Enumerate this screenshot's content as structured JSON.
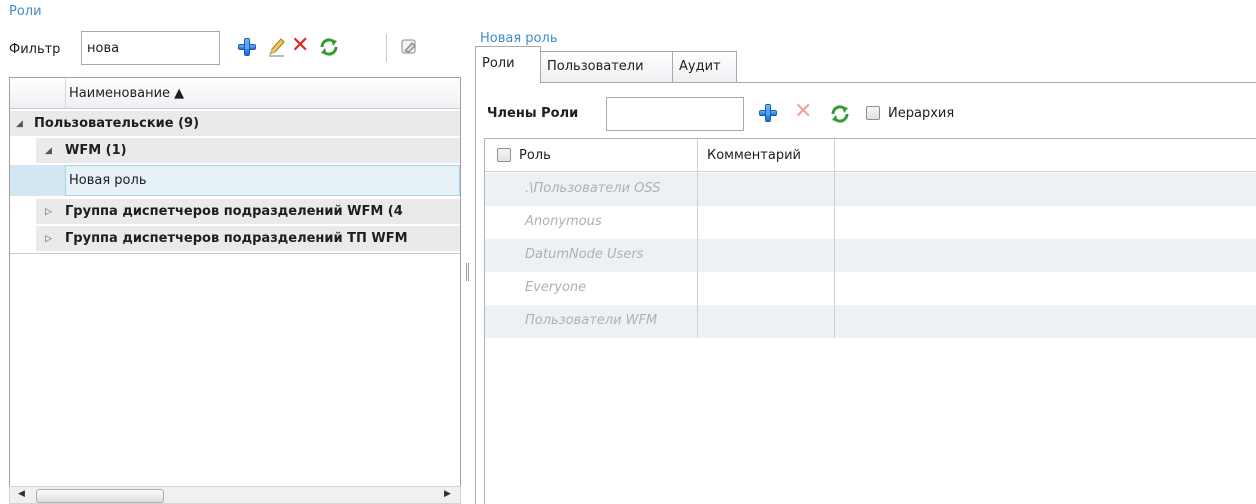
{
  "left": {
    "section_title": "Роли",
    "filter_label": "Фильтр",
    "filter_value": "нова",
    "toolbar": {
      "add_icon": "plus-icon",
      "edit_icon": "pencil-icon",
      "delete_icon": "close-icon",
      "refresh_icon": "refresh-icon",
      "clear_filter_icon": "eraser-icon"
    },
    "grid": {
      "column_header": "Наименование ▲",
      "rows": [
        {
          "label": "Пользовательские (9)",
          "kind": "group",
          "expanded": true
        },
        {
          "label": "WFM (1)",
          "kind": "subgroup",
          "expanded": true
        },
        {
          "label": "Новая роль",
          "kind": "item",
          "selected": true
        },
        {
          "label": "Группа диспетчеров подразделений WFM (4",
          "kind": "subgroup",
          "expanded": false
        },
        {
          "label": "Группа диспетчеров подразделений ТП WFM",
          "kind": "subgroup",
          "expanded": false
        }
      ]
    }
  },
  "right": {
    "section_title": "Новая роль",
    "tabs": [
      {
        "label": "Роли",
        "active": true
      },
      {
        "label": "Пользователи",
        "active": false
      },
      {
        "label": "Аудит",
        "active": false
      }
    ],
    "members_label": "Члены Роли",
    "members_input_value": "",
    "hierarchy_label": "Иерархия",
    "grid": {
      "columns": [
        "Роль",
        "Комментарий"
      ],
      "rows": [
        {
          "role": ".\\Пользователи OSS",
          "comment": ""
        },
        {
          "role": "Anonymous",
          "comment": ""
        },
        {
          "role": "DatumNode Users",
          "comment": ""
        },
        {
          "role": "Everyone",
          "comment": ""
        },
        {
          "role": "Пользователи WFM",
          "comment": ""
        }
      ]
    }
  },
  "colors": {
    "accent_link": "#3c8dcb",
    "selected_row": "#d2e7f1",
    "group_row": "#e9eaec",
    "delete_red": "#e0261b",
    "refresh_green": "#2e9e2e"
  }
}
